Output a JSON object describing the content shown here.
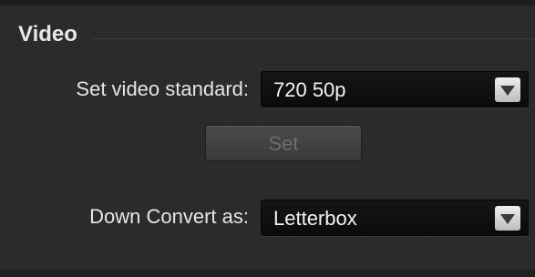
{
  "section": {
    "title": "Video"
  },
  "video_standard": {
    "label": "Set video standard:",
    "value": "720 50p",
    "icon": "chevron-down-icon"
  },
  "set_button": {
    "label": "Set",
    "enabled": false
  },
  "down_convert": {
    "label": "Down Convert as:",
    "value": "Letterbox",
    "icon": "chevron-down-icon"
  },
  "colors": {
    "panel_background": "#2b2b2b",
    "dropdown_background": "#0b0b0b",
    "text": "#e6e6e6",
    "disabled_text": "#6c6c6c"
  }
}
